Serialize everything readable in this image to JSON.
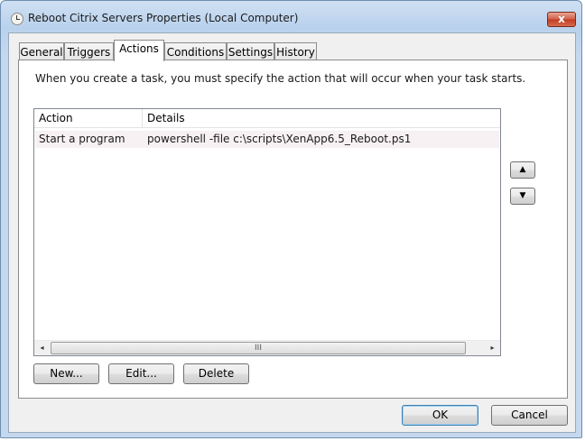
{
  "window": {
    "title": "Reboot Citrix Servers Properties (Local Computer)",
    "close_symbol": "x"
  },
  "tabs": [
    {
      "label": "General"
    },
    {
      "label": "Triggers"
    },
    {
      "label": "Actions",
      "active": true
    },
    {
      "label": "Conditions"
    },
    {
      "label": "Settings"
    },
    {
      "label": "History"
    }
  ],
  "actions_tab": {
    "intro": "When you create a task, you must specify the action that will occur when your task starts.",
    "columns": {
      "action": "Action",
      "details": "Details"
    },
    "rows": [
      {
        "action": "Start a program",
        "details": "powershell -file c:\\scripts\\XenApp6.5_Reboot.ps1"
      }
    ],
    "scroll": {
      "left_arrow": "◂",
      "right_arrow": "▸",
      "grip": "III"
    },
    "move_up_symbol": "▲",
    "move_down_symbol": "▼",
    "buttons": {
      "new": "New...",
      "edit": "Edit...",
      "delete": "Delete"
    }
  },
  "dialog_buttons": {
    "ok": "OK",
    "cancel": "Cancel"
  }
}
